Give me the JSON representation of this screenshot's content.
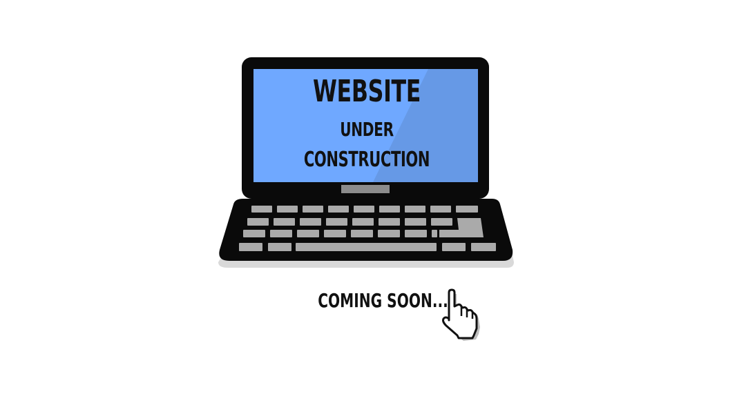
{
  "screen": {
    "line1": "WEBSITE",
    "line2": "UNDER",
    "line3": "CONSTRUCTION"
  },
  "footer": {
    "coming_soon": "COMING SOON..."
  },
  "colors": {
    "screen_blue": "#6fa8ff",
    "screen_blue_shade": "#6699e6",
    "frame_black": "#0a0a0a",
    "key_gray": "#aaaaaa",
    "base_shadow": "#dddddd"
  },
  "icons": {
    "laptop": "laptop-icon",
    "cursor": "hand-pointer-icon"
  }
}
